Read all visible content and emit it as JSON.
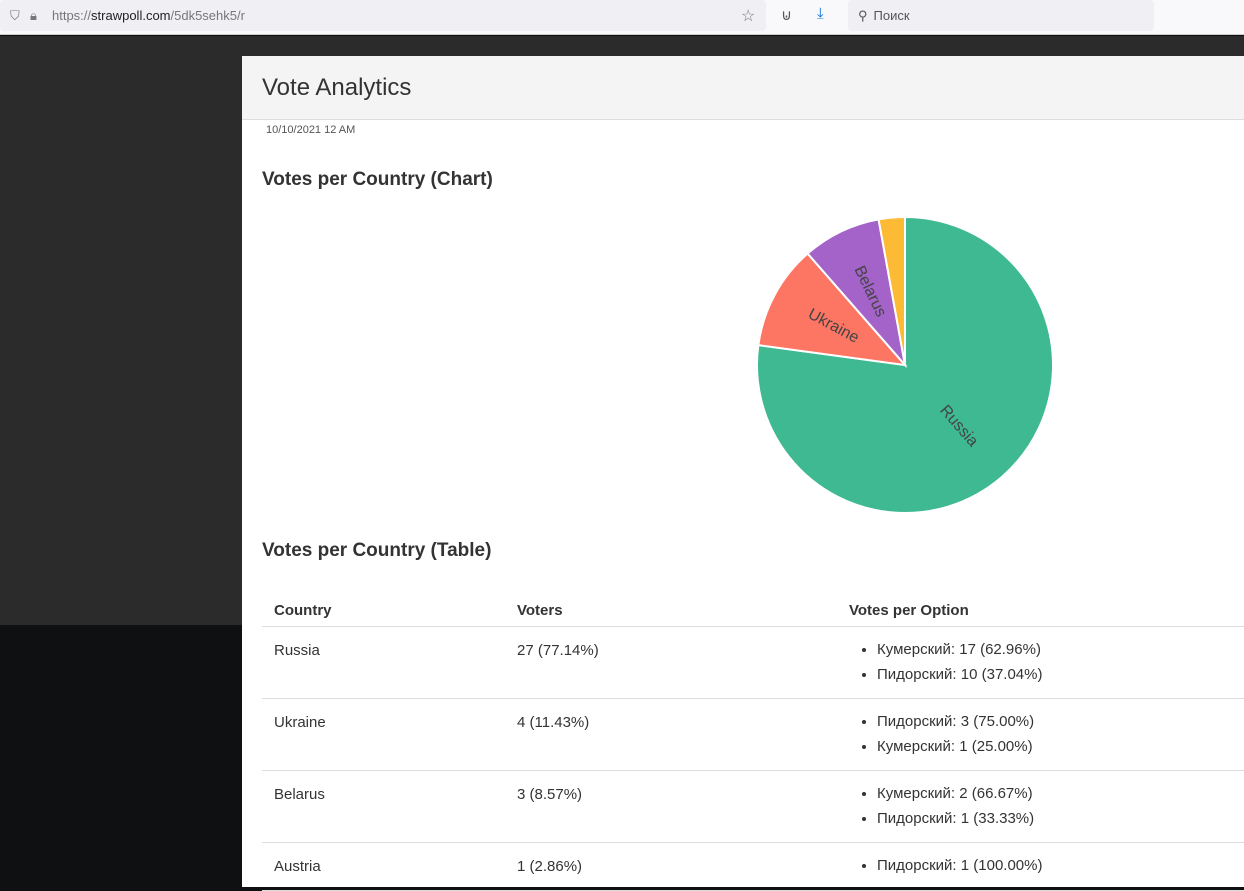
{
  "browser": {
    "url_scheme": "https://",
    "url_host": "strawpoll.com",
    "url_path": "/5dk5sehk5/r",
    "search_placeholder": "Поиск"
  },
  "page": {
    "title": "Vote Analytics",
    "date": "10/10/2021 12 AM",
    "chart_heading": "Votes per Country (Chart)",
    "table_heading": "Votes per Country (Table)"
  },
  "chart_data": {
    "type": "pie",
    "categories": [
      "Russia",
      "Ukraine",
      "Belarus",
      "Austria"
    ],
    "values": [
      27,
      4,
      3,
      1
    ],
    "colors": [
      "#3fb991",
      "#fd7663",
      "#a463c9",
      "#fdba34"
    ],
    "labels_shown": [
      "Russia",
      "Ukraine",
      "Belarus",
      ""
    ]
  },
  "table": {
    "headers": [
      "Country",
      "Voters",
      "Votes per Option"
    ],
    "rows": [
      {
        "country": "Russia",
        "voters": "27 (77.14%)",
        "options": [
          "Кумерский: 17 (62.96%)",
          "Пидорский: 10 (37.04%)"
        ]
      },
      {
        "country": "Ukraine",
        "voters": "4 (11.43%)",
        "options": [
          "Пидорский: 3 (75.00%)",
          "Кумерский: 1 (25.00%)"
        ]
      },
      {
        "country": "Belarus",
        "voters": "3 (8.57%)",
        "options": [
          "Кумерский: 2 (66.67%)",
          "Пидорский: 1 (33.33%)"
        ]
      },
      {
        "country": "Austria",
        "voters": "1 (2.86%)",
        "options": [
          "Пидорский: 1 (100.00%)"
        ]
      }
    ]
  }
}
